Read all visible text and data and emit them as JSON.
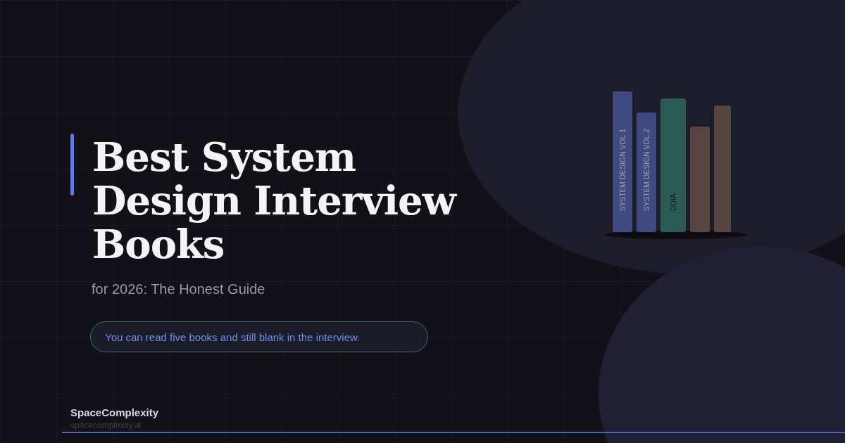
{
  "title": "Best System Design Interview Books",
  "subtitle": "for 2026: The Honest Guide",
  "callout": "You can read five books and still blank in the interview.",
  "books": [
    {
      "label": "SYSTEM DESIGN VOL.1",
      "color": "#414a80"
    },
    {
      "label": "SYSTEM DESIGN VOL.2",
      "color": "#414a80"
    },
    {
      "label": "DDIA",
      "color": "#2b5a52"
    },
    {
      "color": "#57433f"
    },
    {
      "color": "#57433f"
    }
  ],
  "brand": {
    "name": "SpaceComplexity",
    "url": "spacecomplexity.ai"
  }
}
